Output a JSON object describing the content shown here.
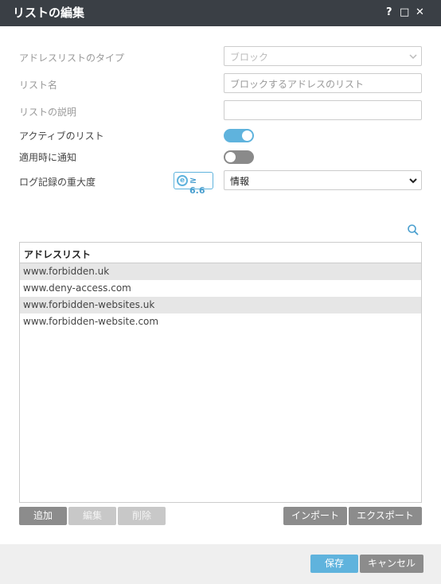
{
  "title": "リストの編集",
  "window_controls": {
    "help": "?",
    "maximize": "□",
    "close": "✕"
  },
  "form": {
    "type_label": "アドレスリストのタイプ",
    "type_value": "ブロック",
    "name_label": "リスト名",
    "name_placeholder": "ブロックするアドレスのリスト",
    "desc_label": "リストの説明",
    "desc_value": "",
    "active_label": "アクティブのリスト",
    "active_on": true,
    "notify_label": "適用時に通知",
    "notify_on": false,
    "log_label": "ログ記録の重大度",
    "log_value": "情報",
    "version_badge": "≥ 6.6",
    "version_badge_icon": "e"
  },
  "list": {
    "header": "アドレスリスト",
    "items": [
      "www.forbidden.uk",
      "www.deny-access.com",
      "www.forbidden-websites.uk",
      "www.forbidden-website.com"
    ]
  },
  "toolbar": {
    "add": "追加",
    "edit": "編集",
    "delete": "削除",
    "import": "インポート",
    "export": "エクスポート"
  },
  "footer": {
    "save": "保存",
    "cancel": "キャンセル"
  },
  "colors": {
    "titlebar": "#3a3f45",
    "accent": "#5fb3dd",
    "toggle_off": "#8a8a8a",
    "button_grey": "#8c8c8c"
  }
}
